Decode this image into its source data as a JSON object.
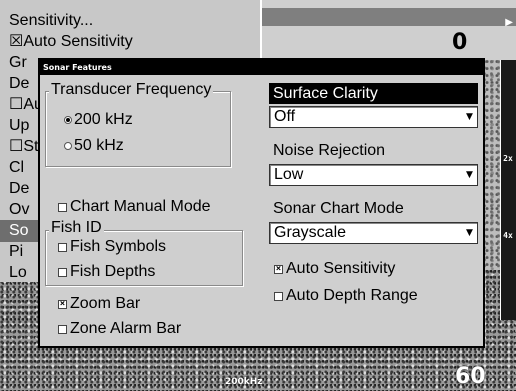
{
  "screen": {
    "depth_top": "0",
    "depth_bottom": "60",
    "frequency_label": "200kHz",
    "zoom_ticks": [
      "2x",
      "4x"
    ]
  },
  "menu": {
    "items": [
      {
        "label": "Sensitivity...",
        "prefix": ""
      },
      {
        "label": "Auto Sensitivity",
        "prefix": "☒"
      },
      {
        "label": "Gr",
        "prefix": ""
      },
      {
        "label": "De",
        "prefix": ""
      },
      {
        "label": "Au",
        "prefix": "☐"
      },
      {
        "label": "Up",
        "prefix": ""
      },
      {
        "label": "St",
        "prefix": "☐"
      },
      {
        "label": "Cl",
        "prefix": ""
      },
      {
        "label": "De",
        "prefix": ""
      },
      {
        "label": "Ov",
        "prefix": ""
      },
      {
        "label": "So",
        "prefix": ""
      },
      {
        "label": "Pi",
        "prefix": ""
      },
      {
        "label": "Lo",
        "prefix": ""
      }
    ]
  },
  "dialog": {
    "title": "Sonar Features",
    "transducer_frequency": {
      "label": "Transducer Frequency",
      "options": [
        {
          "label": "200 kHz",
          "selected": true
        },
        {
          "label": "50 kHz",
          "selected": false
        }
      ]
    },
    "chart_manual_mode": {
      "label": "Chart Manual Mode",
      "checked": false
    },
    "fish_id": {
      "label": "Fish ID",
      "fish_symbols": {
        "label": "Fish Symbols",
        "checked": false
      },
      "fish_depths": {
        "label": "Fish Depths",
        "checked": false
      }
    },
    "zoom_bar": {
      "label": "Zoom Bar",
      "checked": true
    },
    "zone_alarm_bar": {
      "label": "Zone Alarm Bar",
      "checked": false
    },
    "surface_clarity": {
      "label": "Surface Clarity",
      "value": "Off"
    },
    "noise_rejection": {
      "label": "Noise Rejection",
      "value": "Low"
    },
    "sonar_chart_mode": {
      "label": "Sonar Chart Mode",
      "value": "Grayscale"
    },
    "auto_sensitivity": {
      "label": "Auto Sensitivity",
      "checked": true
    },
    "auto_depth_range": {
      "label": "Auto Depth Range",
      "checked": false
    }
  }
}
